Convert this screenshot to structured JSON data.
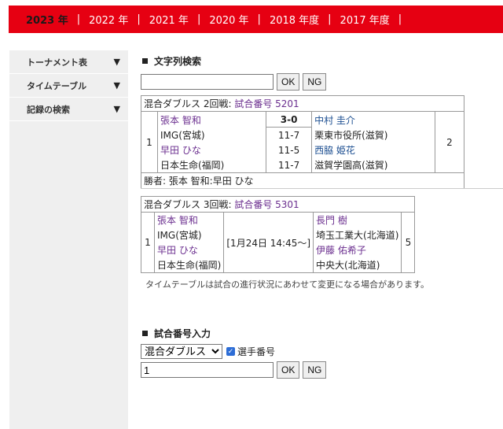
{
  "topbar": {
    "years": [
      {
        "label": "2023 年",
        "active": true
      },
      {
        "label": "2022 年",
        "active": false
      },
      {
        "label": "2021 年",
        "active": false
      },
      {
        "label": "2020 年",
        "active": false
      },
      {
        "label": "2018 年度",
        "active": false
      },
      {
        "label": "2017 年度",
        "active": false
      }
    ],
    "separator": "|"
  },
  "sidebar": {
    "items": [
      {
        "label": "トーナメント表",
        "arrow": "▼"
      },
      {
        "label": "タイムテーブル",
        "arrow": "▼"
      },
      {
        "label": "記録の検索",
        "arrow": "▼"
      }
    ]
  },
  "search": {
    "title": "文字列検索",
    "value": "",
    "ok_label": "OK",
    "ng_label": "NG"
  },
  "match1": {
    "header_prefix": "混合ダブルス 2回戦:",
    "header_link": "試合番号 5201",
    "left_num": "1",
    "right_num": "2",
    "left_players": [
      "張本 智和",
      "IMG(宮城)",
      "早田 ひな",
      "日本生命(福岡)"
    ],
    "scores": [
      "3-0",
      "11-7",
      "11-5",
      "11-7"
    ],
    "right_players": [
      "中村 圭介",
      "栗東市役所(滋賀)",
      "西脇 姫花",
      "滋賀学園高(滋賀)"
    ],
    "winner": "勝者: 張本 智和:早田 ひな"
  },
  "match2": {
    "header_prefix": "混合ダブルス 3回戦:",
    "header_link": "試合番号 5301",
    "left_num": "1",
    "right_num": "5",
    "left_players": [
      "張本 智和",
      "IMG(宮城)",
      "早田 ひな",
      "日本生命(福岡)"
    ],
    "schedule": "[1月24日 14:45～]",
    "right_players": [
      "長門 樹",
      "埼玉工業大(北海道)",
      "伊藤 佑希子",
      "中央大(北海道)"
    ]
  },
  "note": "タイムテーブルは試合の進行状況にあわせて変更になる場合があります。",
  "number_input": {
    "title": "試合番号入力",
    "select_value": "混合ダブルス",
    "checkbox_label": "選手番号",
    "value": "1",
    "ok_label": "OK",
    "ng_label": "NG"
  },
  "colors": {
    "topbar": "#e60012",
    "sidebar": "#efefef",
    "purple": "#6b2f8f",
    "blue": "#1d4f91"
  }
}
